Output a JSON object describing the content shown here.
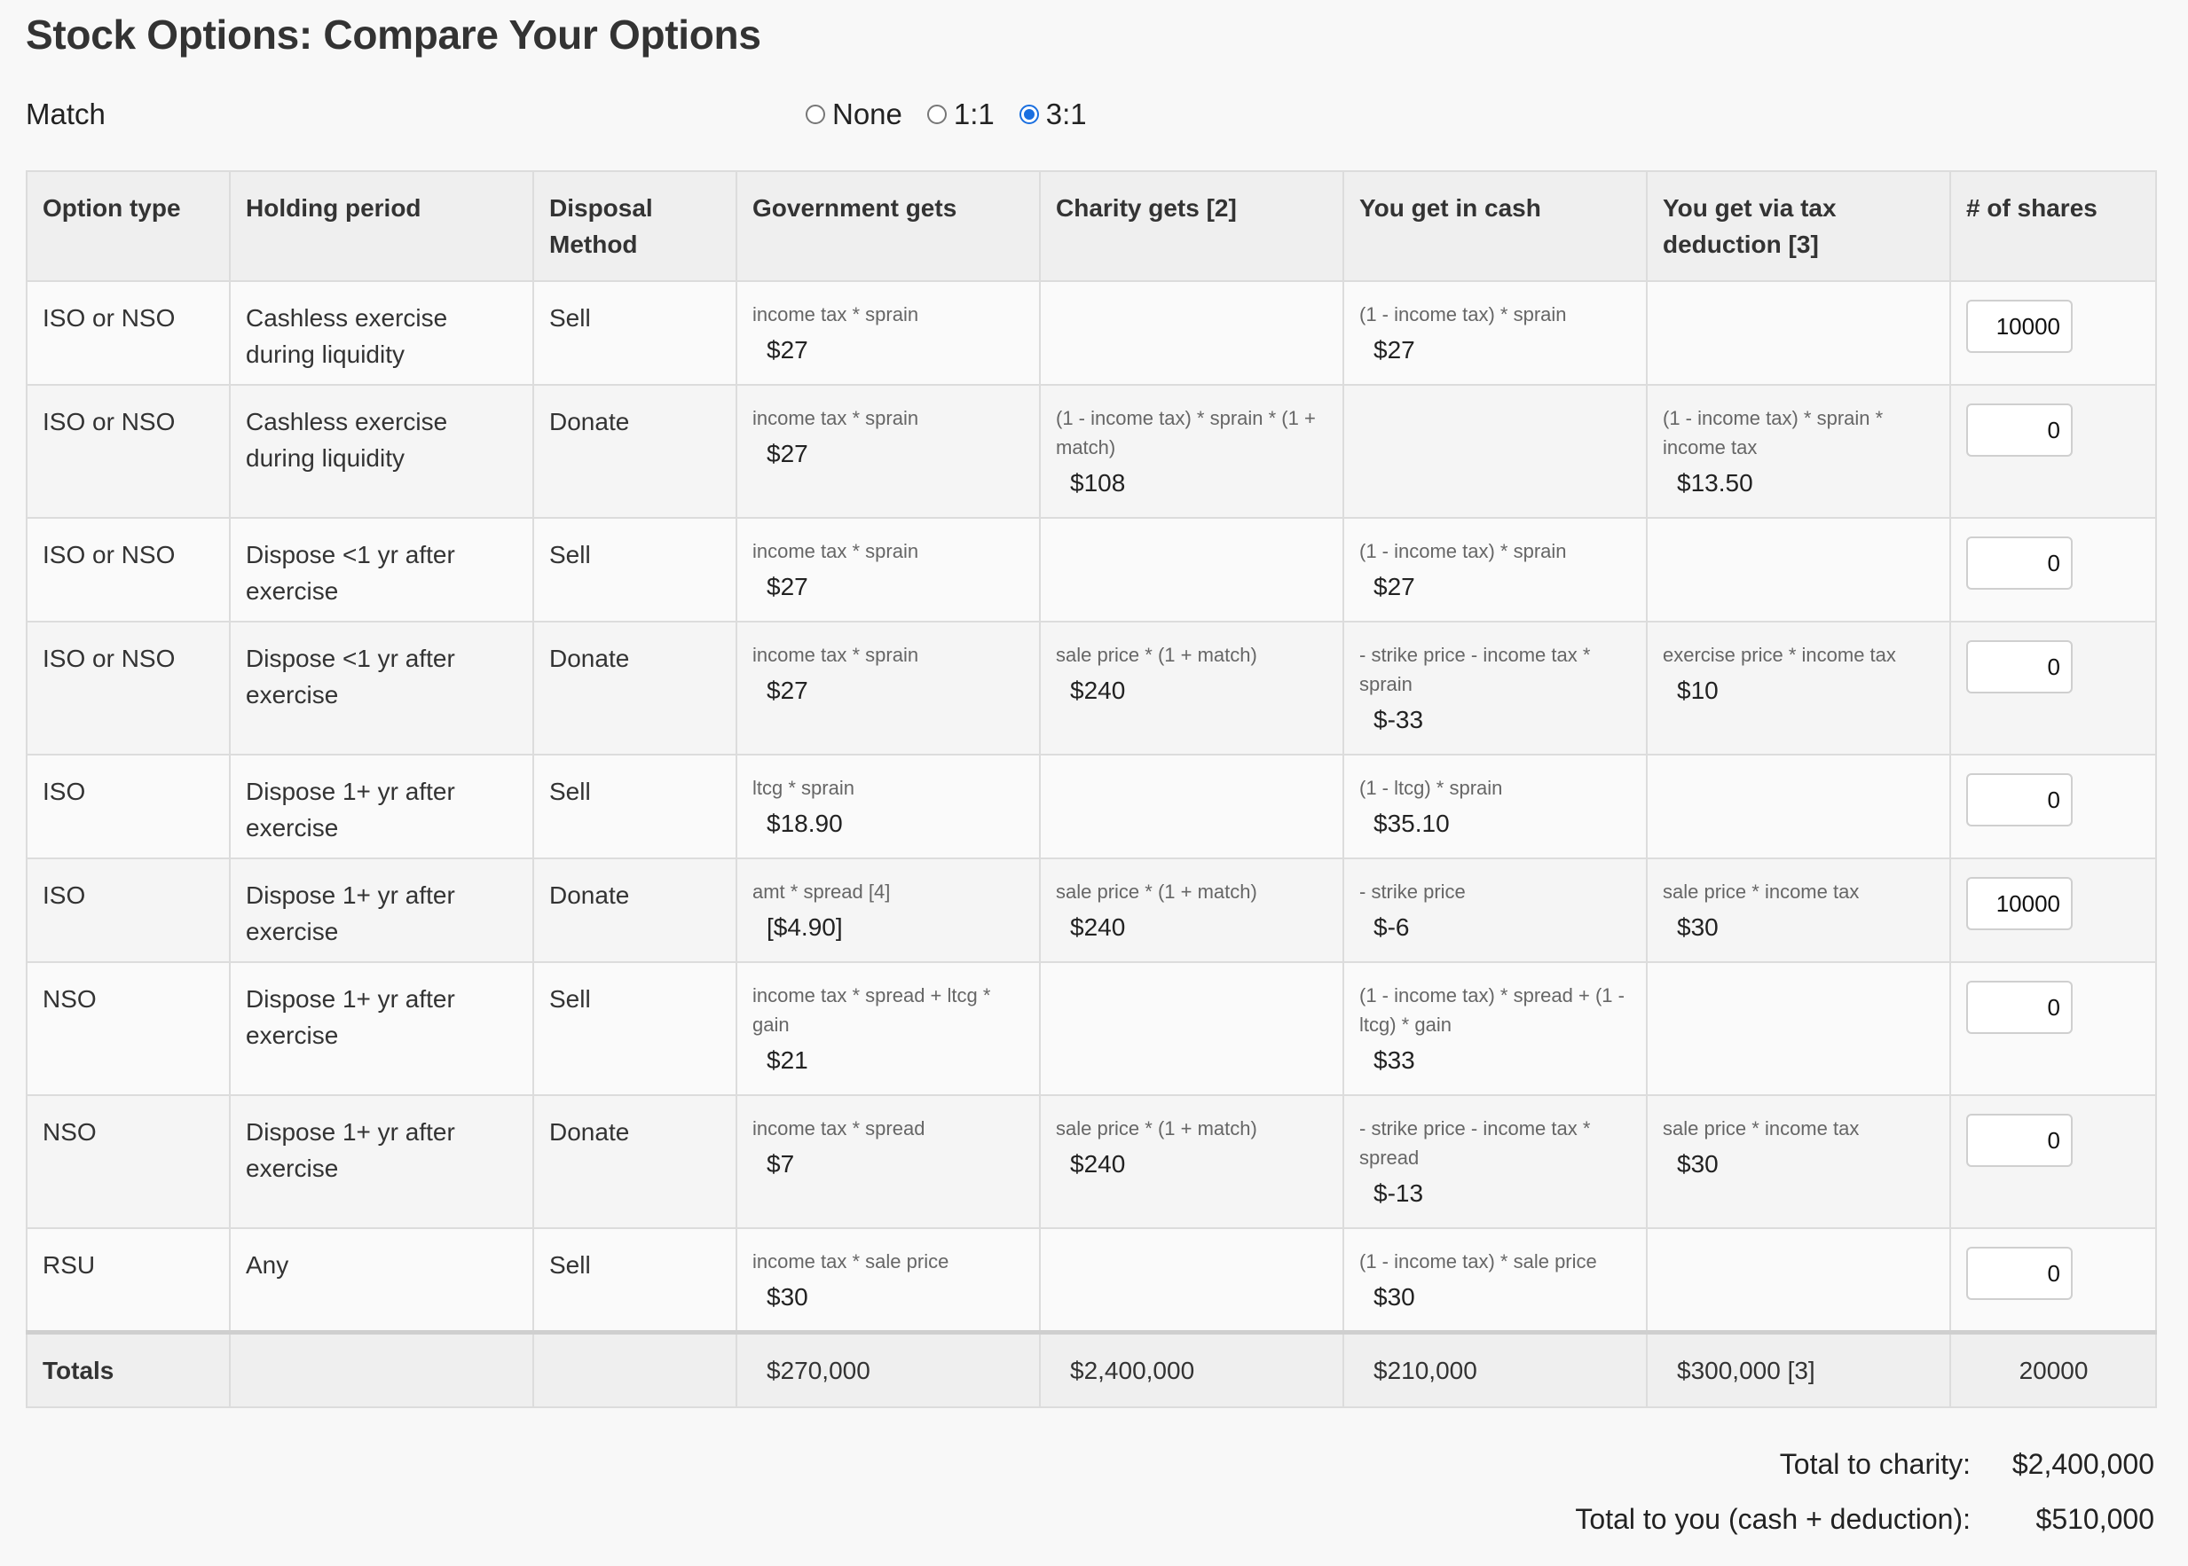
{
  "title": "Stock Options: Compare Your Options",
  "match": {
    "label": "Match",
    "options": [
      {
        "label": "None",
        "checked": false
      },
      {
        "label": "1:1",
        "checked": false
      },
      {
        "label": "3:1",
        "checked": true
      }
    ]
  },
  "table": {
    "headers": [
      "Option type",
      "Holding period",
      "Disposal Method",
      "Government gets",
      "Charity gets [2]",
      "You get in cash",
      "You get via tax deduction [3]",
      "# of shares"
    ],
    "rows": [
      {
        "type": "ISO or NSO",
        "period": "Cashless exercise during liquidity",
        "method": "Sell",
        "gov": {
          "f": "income tax * sprain",
          "v": "$27"
        },
        "charity": {
          "f": "",
          "v": ""
        },
        "cash": {
          "f": "(1 - income tax) * sprain",
          "v": "$27"
        },
        "deduction": {
          "f": "",
          "v": ""
        },
        "shares": "10000"
      },
      {
        "type": "ISO or NSO",
        "period": "Cashless exercise during liquidity",
        "method": "Donate",
        "gov": {
          "f": "income tax * sprain",
          "v": "$27"
        },
        "charity": {
          "f": "(1 - income tax) * sprain * (1 + match)",
          "v": "$108"
        },
        "cash": {
          "f": "",
          "v": ""
        },
        "deduction": {
          "f": "(1 - income tax) * sprain * income tax",
          "v": "$13.50"
        },
        "shares": "0"
      },
      {
        "type": "ISO or NSO",
        "period": "Dispose <1 yr after exercise",
        "method": "Sell",
        "gov": {
          "f": "income tax * sprain",
          "v": "$27"
        },
        "charity": {
          "f": "",
          "v": ""
        },
        "cash": {
          "f": "(1 - income tax) * sprain",
          "v": "$27"
        },
        "deduction": {
          "f": "",
          "v": ""
        },
        "shares": "0"
      },
      {
        "type": "ISO or NSO",
        "period": "Dispose <1 yr after exercise",
        "method": "Donate",
        "gov": {
          "f": "income tax * sprain",
          "v": "$27"
        },
        "charity": {
          "f": "sale price * (1 + match)",
          "v": "$240"
        },
        "cash": {
          "f": "- strike price - income tax * sprain",
          "v": "$-33"
        },
        "deduction": {
          "f": "exercise price * income tax",
          "v": "$10"
        },
        "shares": "0"
      },
      {
        "type": "ISO",
        "period": "Dispose 1+ yr after exercise",
        "method": "Sell",
        "gov": {
          "f": "ltcg * sprain",
          "v": "$18.90"
        },
        "charity": {
          "f": "",
          "v": ""
        },
        "cash": {
          "f": "(1 - ltcg) * sprain",
          "v": "$35.10"
        },
        "deduction": {
          "f": "",
          "v": ""
        },
        "shares": "0"
      },
      {
        "type": "ISO",
        "period": "Dispose 1+ yr after exercise",
        "method": "Donate",
        "gov": {
          "f": "amt * spread [4]",
          "v": "[$4.90]"
        },
        "charity": {
          "f": "sale price * (1 + match)",
          "v": "$240"
        },
        "cash": {
          "f": "- strike price",
          "v": "$-6"
        },
        "deduction": {
          "f": "sale price * income tax",
          "v": "$30"
        },
        "shares": "10000"
      },
      {
        "type": "NSO",
        "period": "Dispose 1+ yr after exercise",
        "method": "Sell",
        "gov": {
          "f": "income tax * spread + ltcg * gain",
          "v": "$21"
        },
        "charity": {
          "f": "",
          "v": ""
        },
        "cash": {
          "f": "(1 - income tax) * spread + (1 - ltcg) * gain",
          "v": "$33"
        },
        "deduction": {
          "f": "",
          "v": ""
        },
        "shares": "0"
      },
      {
        "type": "NSO",
        "period": "Dispose 1+ yr after exercise",
        "method": "Donate",
        "gov": {
          "f": "income tax * spread",
          "v": "$7"
        },
        "charity": {
          "f": "sale price * (1 + match)",
          "v": "$240"
        },
        "cash": {
          "f": "- strike price - income tax * spread",
          "v": "$-13"
        },
        "deduction": {
          "f": "sale price * income tax",
          "v": "$30"
        },
        "shares": "0"
      },
      {
        "type": "RSU",
        "period": "Any",
        "method": "Sell",
        "gov": {
          "f": "income tax * sale price",
          "v": "$30"
        },
        "charity": {
          "f": "",
          "v": ""
        },
        "cash": {
          "f": "(1 - income tax) * sale price",
          "v": "$30"
        },
        "deduction": {
          "f": "",
          "v": ""
        },
        "shares": "0"
      }
    ],
    "totals": {
      "label": "Totals",
      "gov": "$270,000",
      "charity": "$2,400,000",
      "cash": "$210,000",
      "deduction": "$300,000 [3]",
      "shares": "20000"
    }
  },
  "summary": {
    "charity_label": "Total to charity:",
    "charity_value": "$2,400,000",
    "you_label": "Total to you (cash + deduction):",
    "you_value": "$510,000"
  },
  "colors": {
    "accent": "#1a6fe0",
    "header_bg": "#efefef",
    "border": "#dcdcdc"
  }
}
